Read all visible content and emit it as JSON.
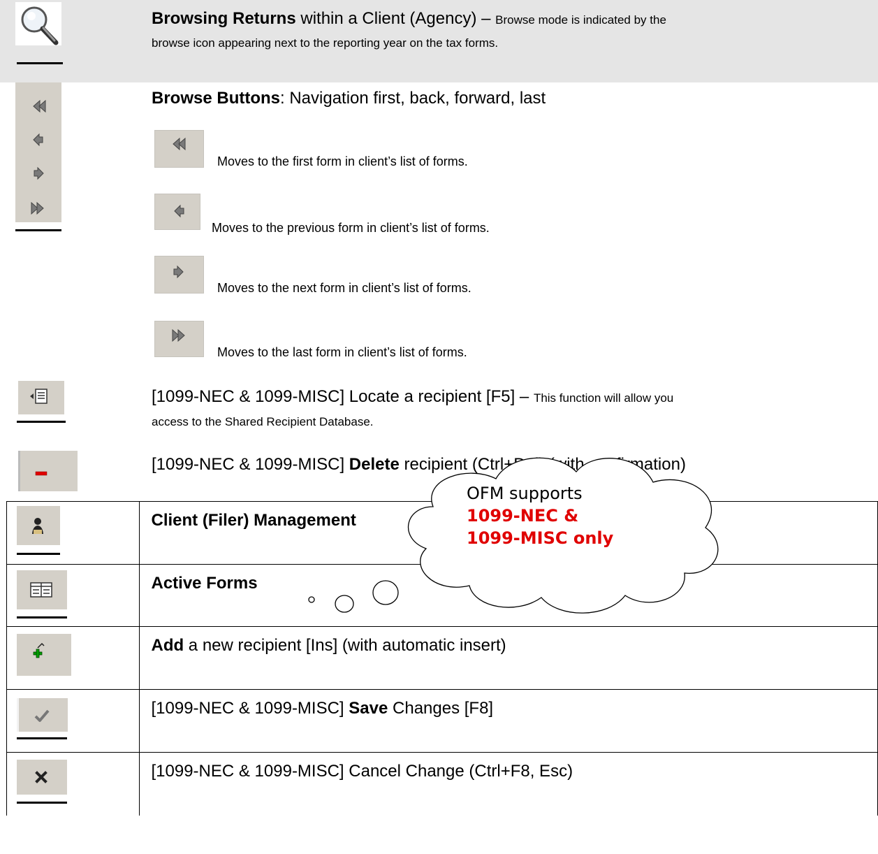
{
  "browse_section": {
    "title_bold": "Browsing Returns",
    "title_rest": " within a Client (Agency) – ",
    "title_small": "Browse mode is indicated by the",
    "line2": "browse icon appearing next to the reporting year on the tax forms.",
    "icon": "magnifier-icon"
  },
  "browse_buttons": {
    "title_bold": "Browse Buttons",
    "title_rest": ":  Navigation first, back, forward, last",
    "items": [
      {
        "icon": "first-icon",
        "desc": "Moves to the first form in client’s list of forms."
      },
      {
        "icon": "previous-icon",
        "desc": "Moves to the previous form in client’s list of forms."
      },
      {
        "icon": "next-icon",
        "desc": "Moves to the next form in client’s list of forms."
      },
      {
        "icon": "last-icon",
        "desc": "Moves to the last form in client’s list of forms."
      }
    ]
  },
  "locate": {
    "title": "[1099-NEC & 1099-MISC] Locate a recipient [F5] – ",
    "small": "This function will allow you",
    "line2": "access to the Shared Recipient Database.",
    "icon": "locate-recipient-icon"
  },
  "delete": {
    "prefix": "[1099-NEC & 1099-MISC] ",
    "bold": "Delete",
    "rest": " recipient (Ctrl+Del) (with confirmation)",
    "icon": "minus-icon"
  },
  "table_rows": [
    {
      "icon": "client-icon",
      "prefix": "",
      "bold": "Client (Filer) Management",
      "rest": ""
    },
    {
      "icon": "active-forms-icon",
      "prefix": "",
      "bold": "Active Forms",
      "rest": ""
    },
    {
      "icon": "add-icon",
      "prefix": "",
      "bold": "Add",
      "rest": " a new recipient [Ins] (with automatic insert)"
    },
    {
      "icon": "check-icon",
      "prefix": "[1099-NEC & 1099-MISC] ",
      "bold": "Save",
      "rest": " Changes [F8]"
    },
    {
      "icon": "x-icon",
      "prefix": "[1099-NEC & 1099-MISC] Cancel Change (Ctrl+F8, Esc)",
      "bold": "",
      "rest": ""
    }
  ],
  "callout": {
    "line1": "OFM supports",
    "line2": "1099-NEC &",
    "line3": "1099-MISC only"
  }
}
